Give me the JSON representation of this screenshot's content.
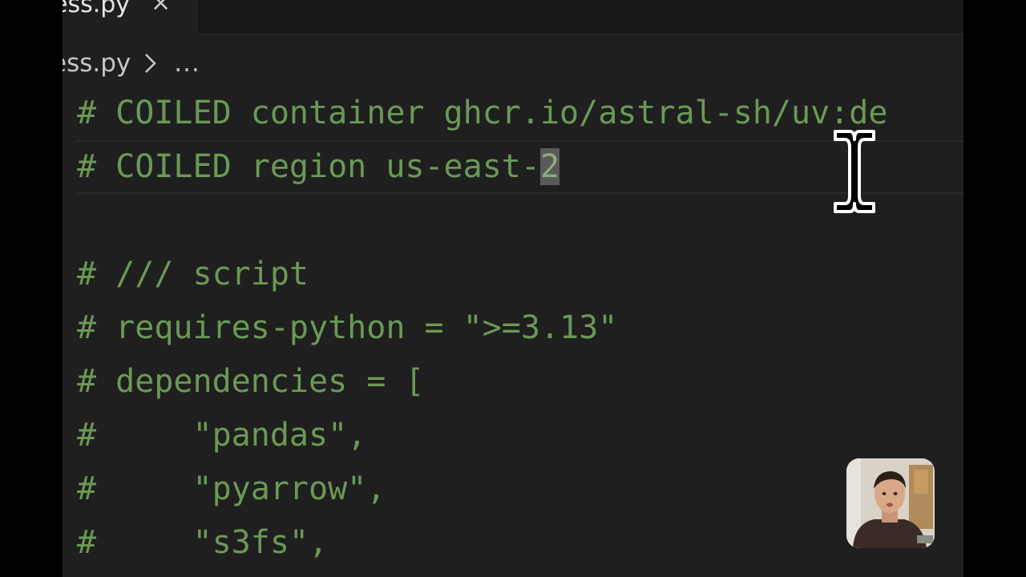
{
  "tab": {
    "label": "ess.py",
    "close_icon": "close-icon"
  },
  "breadcrumb": {
    "file": "ess.py",
    "ellipsis": "..."
  },
  "code_lines": [
    {
      "text": "# COILED container ghcr.io/astral-sh/uv:de"
    },
    {
      "before": "# COILED region us-east-",
      "selected": "2"
    },
    {
      "text": ""
    },
    {
      "text": "# /// script"
    },
    {
      "text": "# requires-python = \">=3.13\""
    },
    {
      "text": "# dependencies = ["
    },
    {
      "text": "#     \"pandas\","
    },
    {
      "text": "#     \"pyarrow\","
    },
    {
      "text": "#     \"s3fs\","
    }
  ],
  "colors": {
    "comment": "#6a9955",
    "editor_bg": "#1f1f1f",
    "selection": "#5a5a5a"
  },
  "icons": {
    "cursor": "text-cursor-icon",
    "chevron": "chevron-right-icon"
  }
}
